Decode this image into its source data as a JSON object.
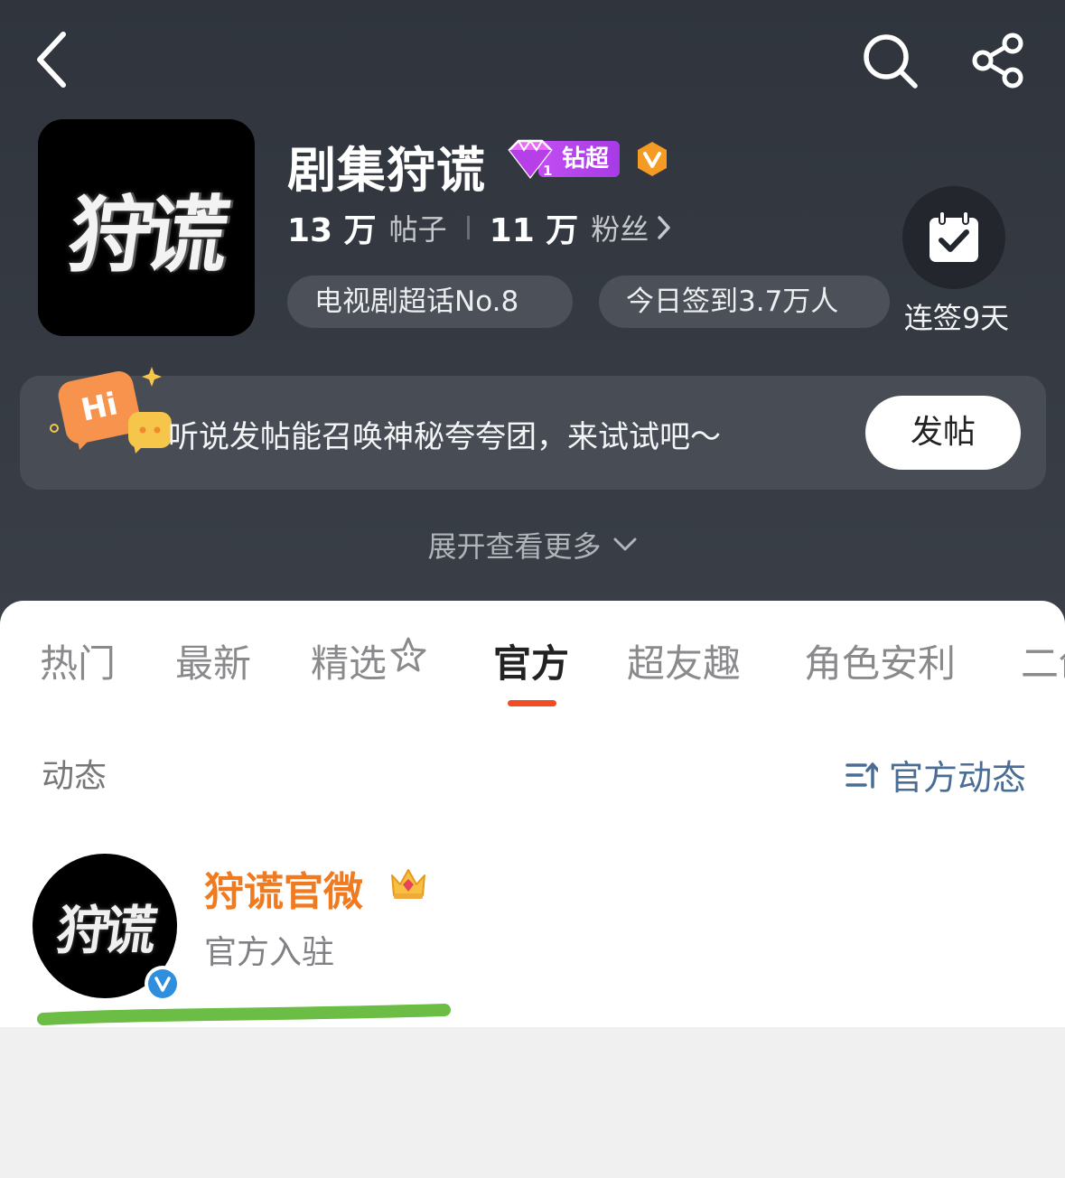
{
  "nav": {
    "back_icon": "chevron-left-icon",
    "search_icon": "search-icon",
    "share_icon": "share-icon"
  },
  "topic": {
    "cover_text": "狩谎",
    "name": "剧集狩谎",
    "tier_label": "钻超",
    "tier_level": "1",
    "posts_count": "13 万",
    "posts_label": "帖子",
    "fans_count": "11 万",
    "fans_label": "粉丝",
    "rank_pill": "电视剧超话No.8",
    "checkin_pill": "今日签到3.7万人",
    "checkin_streak": "连签9天"
  },
  "promo": {
    "bubble_text": "Hi",
    "text": "听说发帖能召唤神秘夸夸团，来试试吧～",
    "post_button": "发帖"
  },
  "expand": {
    "label": "展开查看更多"
  },
  "tabs": [
    {
      "label": "热门"
    },
    {
      "label": "最新"
    },
    {
      "label": "精选"
    },
    {
      "label": "官方"
    },
    {
      "label": "超友趣"
    },
    {
      "label": "角色安利"
    },
    {
      "label": "二创"
    }
  ],
  "active_tab": "官方",
  "section": {
    "label": "动态",
    "sort_label": "官方动态"
  },
  "account": {
    "avatar_text": "狩谎",
    "name": "狩谎官微",
    "subtitle": "官方入驻"
  },
  "colors": {
    "header_bg": "#30353d",
    "accent_orange": "#f07a1f",
    "tab_indicator": "#f04e22",
    "tier_purple": "#b043ee",
    "link_blue": "#4a6d96",
    "highlight_green": "#6cbd45"
  }
}
